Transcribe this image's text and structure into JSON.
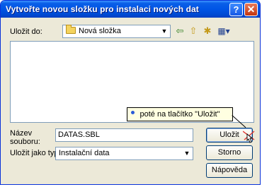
{
  "window": {
    "title": "Vytvořte novou složku pro instalaci nových dat",
    "help_glyph": "?",
    "close_glyph": "✕"
  },
  "location": {
    "label": "Uložit do:",
    "value": "Nová složka",
    "icon": "folder-icon"
  },
  "toolbar": {
    "back": "⇦",
    "up": "⇧",
    "new_folder": "✱",
    "view": "▦▾"
  },
  "tooltip": {
    "text": "poté na tlačítko \"Uložit\""
  },
  "filename": {
    "label_line1": "Název",
    "label_line2": "souboru:",
    "value": "DATAS.SBL"
  },
  "filetype": {
    "label": "Uložit jako typ:",
    "value": "Instalační data"
  },
  "buttons": {
    "save": "Uložit",
    "cancel": "Storno",
    "help": "Nápověda"
  }
}
